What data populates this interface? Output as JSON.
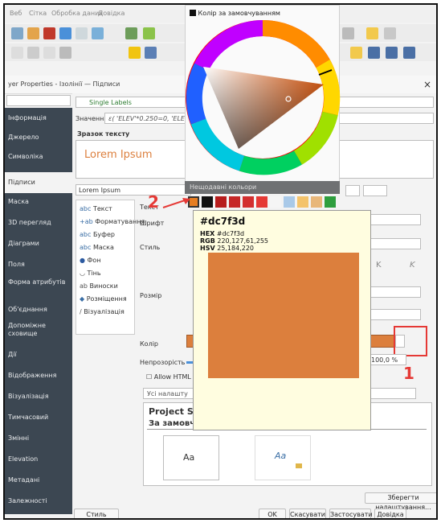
{
  "menu": [
    "Веб",
    "Сітка",
    "Обробка даних",
    "Довідка"
  ],
  "dialog": {
    "title": "yer Properties - Ізолінії — Підписи",
    "close": "×"
  },
  "sidebar": [
    "Інформація",
    "Джерело",
    "Символіка",
    "Підписи",
    "Маска",
    "3D перегляд",
    "Діаграми",
    "Поля",
    "Форма атрибутів",
    "Об'єднання",
    "Допоміжне сховище",
    "Дії",
    "Відображення",
    "Візуалізація",
    "Тимчасовий",
    "Змінні",
    "Elevation",
    "Метадані",
    "Залежності"
  ],
  "labels_mode": "Single Labels",
  "value_label": "Значення",
  "value_expr": "ε( 'ELEV'*0.250=0, 'ELE",
  "sample_section": "Зразок тексту",
  "sample_text": "Lorem Ipsum",
  "sample_input": "Lorem Ipsum",
  "categories": [
    {
      "icon": "abc",
      "label": "Текст"
    },
    {
      "icon": "+ab",
      "label": "Форматування"
    },
    {
      "icon": "abc",
      "label": "Буфер"
    },
    {
      "icon": "abc",
      "label": "Маска"
    },
    {
      "icon": "●",
      "label": "Фон"
    },
    {
      "icon": "◡",
      "label": "Тінь"
    },
    {
      "icon": "ab",
      "label": "Виноски"
    },
    {
      "icon": "◆",
      "label": "Розміщення"
    },
    {
      "icon": "/",
      "label": "Візуалізація"
    }
  ],
  "props": {
    "text": "Текст",
    "font": "Шрифт",
    "style": "Стиль",
    "size": "Розмір",
    "color": "Колір",
    "opacity": "Непрозорість",
    "opacity_value": "100,0 %",
    "allow_html": "Allow HTML fo"
  },
  "search_placeholder": "Усі налашту",
  "styles": {
    "title": "Project Styles",
    "default": "За замовчуванням",
    "aa1": "Aa",
    "aa2": "Aa"
  },
  "popup": {
    "header": "Колір за замовчуванням",
    "recent": "Нещодавні кольори"
  },
  "tooltip": {
    "hex_title": "#dc7f3d",
    "hex_label": "HEX",
    "hex_value": "#dc7f3d",
    "rgb_label": "RGB",
    "rgb_value": "220,127,61,255",
    "hsv_label": "HSV",
    "hsv_value": "25,184,220"
  },
  "buttons": {
    "save": "Зберегти налаштування...",
    "style": "Стиль",
    "ok": "OK",
    "cancel": "Скасувати",
    "apply": "Застосувати",
    "help": "Довідка"
  },
  "annotations": {
    "one": "1",
    "two": "2"
  },
  "colors": {
    "selected": "#dc7f3d",
    "sidebar": "#3c4752",
    "annotation": "#e53935"
  },
  "recent_colors": [
    "#e67e22",
    "#111111",
    "#b71c1c",
    "#c62828",
    "#d32f2f",
    "#e53935",
    "#f5f5f5",
    "#a9c9e8",
    "#f4c36b",
    "#e8b77a",
    "#2e9e3e"
  ]
}
